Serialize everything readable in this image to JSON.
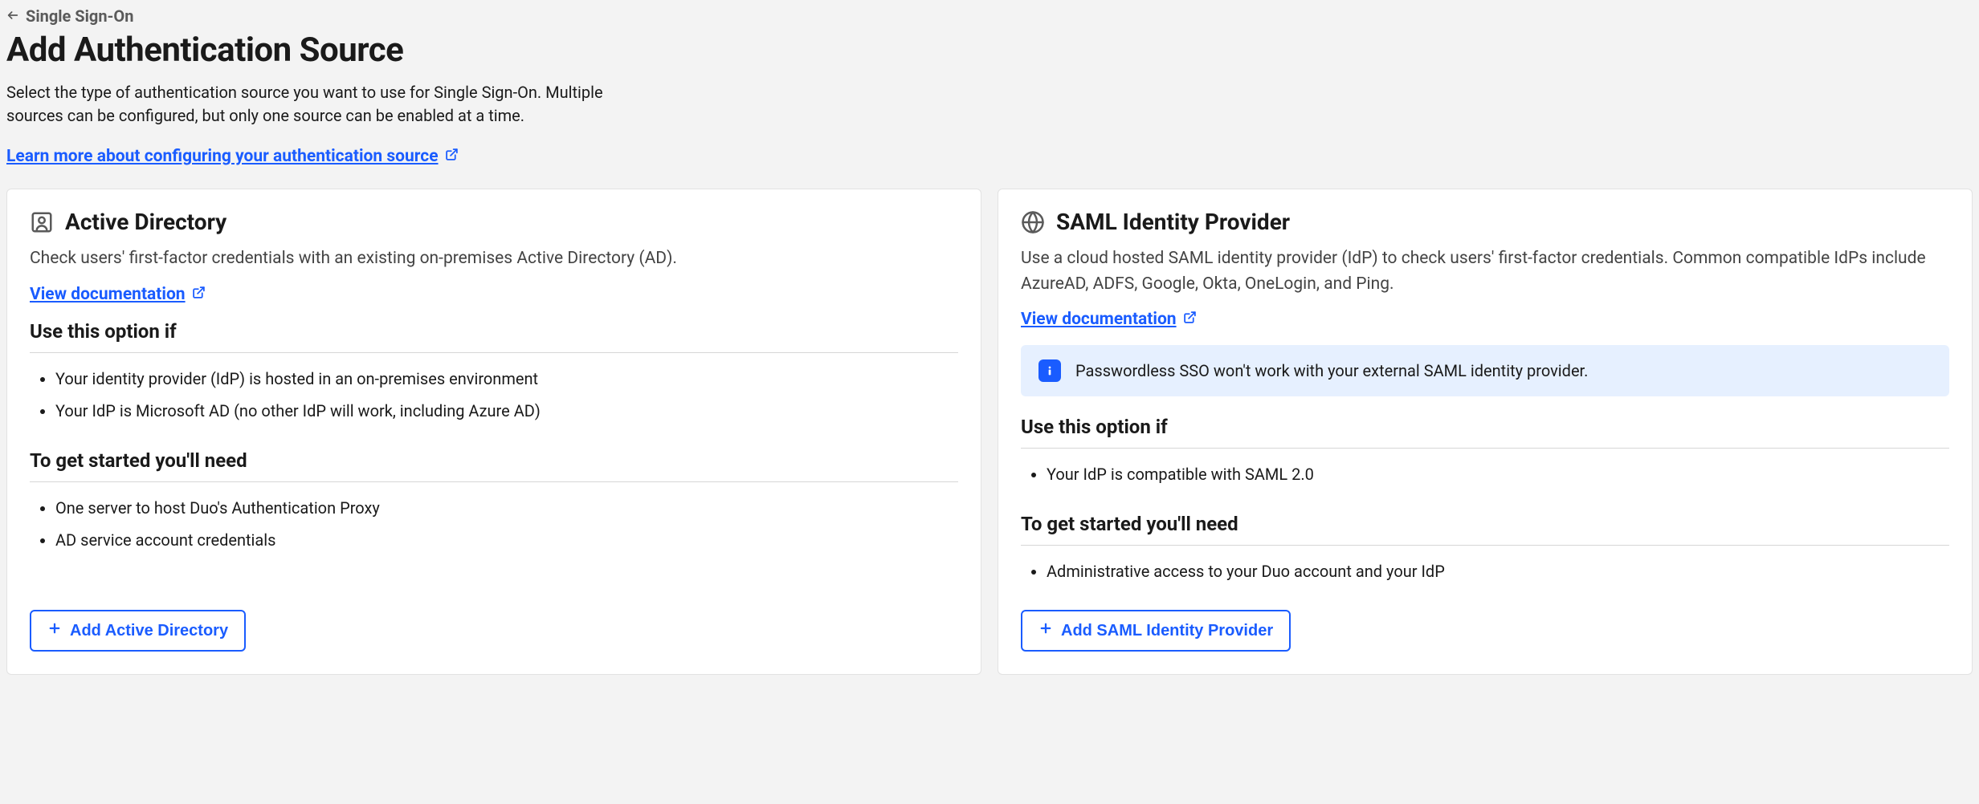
{
  "breadcrumb": {
    "label": "Single Sign-On"
  },
  "header": {
    "title": "Add Authentication Source",
    "description": "Select the type of authentication source you want to use for Single Sign-On. Multiple sources can be configured, but only one source can be enabled at a time.",
    "learn_more": "Learn more about configuring your authentication source"
  },
  "cards": {
    "ad": {
      "title": "Active Directory",
      "description": "Check users' first-factor credentials with an existing on-premises Active Directory (AD).",
      "doc_link": "View documentation",
      "use_if_heading": "Use this option if",
      "use_if": {
        "0": "Your identity provider (IdP) is hosted in an on-premises environment",
        "1": "Your IdP is Microsoft AD (no other IdP will work, including Azure AD)"
      },
      "need_heading": "To get started you'll need",
      "need": {
        "0": "One server to host Duo's Authentication Proxy",
        "1": "AD service account credentials"
      },
      "button": "Add Active Directory"
    },
    "saml": {
      "title": "SAML Identity Provider",
      "description": "Use a cloud hosted SAML identity provider (IdP) to check users' first-factor credentials. Common compatible IdPs include AzureAD, ADFS, Google, Okta, OneLogin, and Ping.",
      "doc_link": "View documentation",
      "info_banner": "Passwordless SSO won't work with your external SAML identity provider.",
      "use_if_heading": "Use this option if",
      "use_if": {
        "0": "Your IdP is compatible with SAML 2.0"
      },
      "need_heading": "To get started you'll need",
      "need": {
        "0": "Administrative access to your Duo account and your IdP"
      },
      "button": "Add SAML Identity Provider"
    }
  }
}
